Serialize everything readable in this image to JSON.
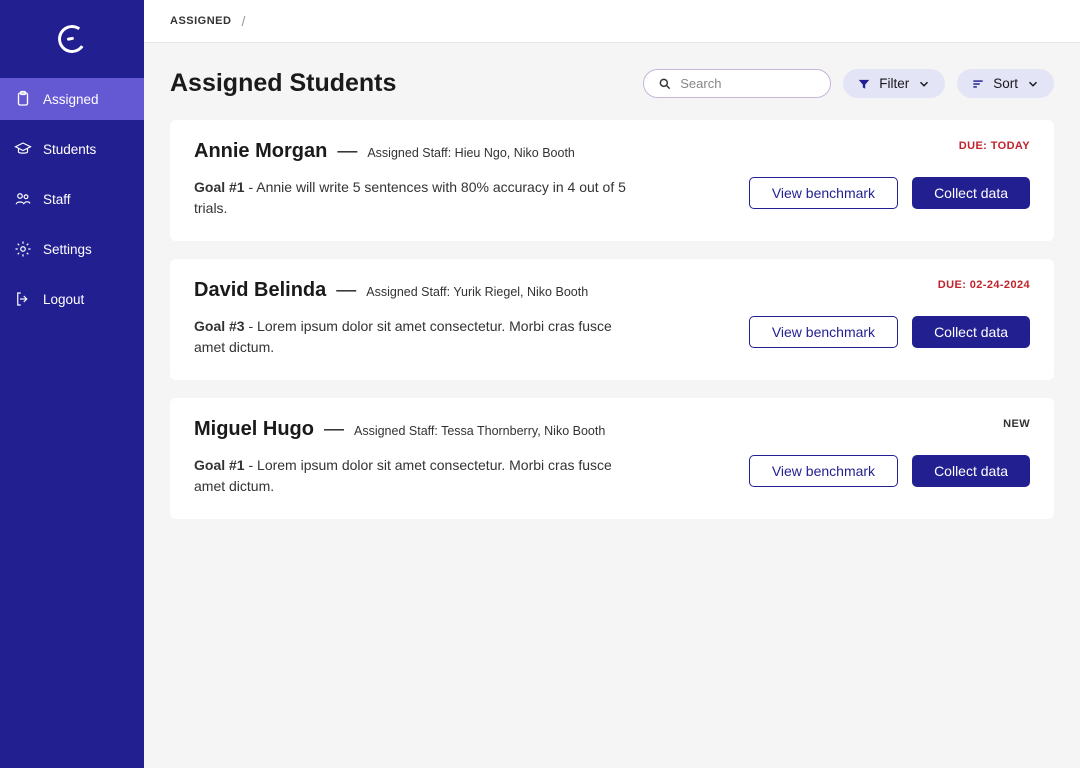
{
  "sidebar": {
    "items": [
      {
        "label": "Assigned"
      },
      {
        "label": "Students"
      },
      {
        "label": "Staff"
      },
      {
        "label": "Settings"
      },
      {
        "label": "Logout"
      }
    ]
  },
  "breadcrumb": {
    "item0": "ASSIGNED",
    "sep": "/"
  },
  "page": {
    "title": "Assigned Students"
  },
  "controls": {
    "search_placeholder": "Search",
    "filter_label": "Filter",
    "sort_label": "Sort"
  },
  "buttons": {
    "view_benchmark": "View benchmark",
    "collect_data": "Collect data"
  },
  "cards": [
    {
      "student_name": "Annie Morgan",
      "staff_line": "Assigned Staff: Hieu Ngo, Niko Booth",
      "badge": "DUE: TODAY",
      "badge_type": "due",
      "goal_label": "Goal #1",
      "goal_text": " - Annie will write 5 sentences with 80% accuracy in 4 out of 5 trials."
    },
    {
      "student_name": "David Belinda",
      "staff_line": "Assigned Staff: Yurik Riegel, Niko Booth",
      "badge": "DUE: 02-24-2024",
      "badge_type": "due",
      "goal_label": "Goal #3",
      "goal_text": " - Lorem ipsum dolor sit amet consectetur. Morbi cras fusce amet dictum."
    },
    {
      "student_name": "Miguel Hugo",
      "staff_line": "Assigned Staff: Tessa Thornberry, Niko Booth",
      "badge": "NEW",
      "badge_type": "new",
      "goal_label": "Goal #1",
      "goal_text": " - Lorem ipsum dolor sit amet consectetur. Morbi cras fusce amet dictum."
    }
  ]
}
